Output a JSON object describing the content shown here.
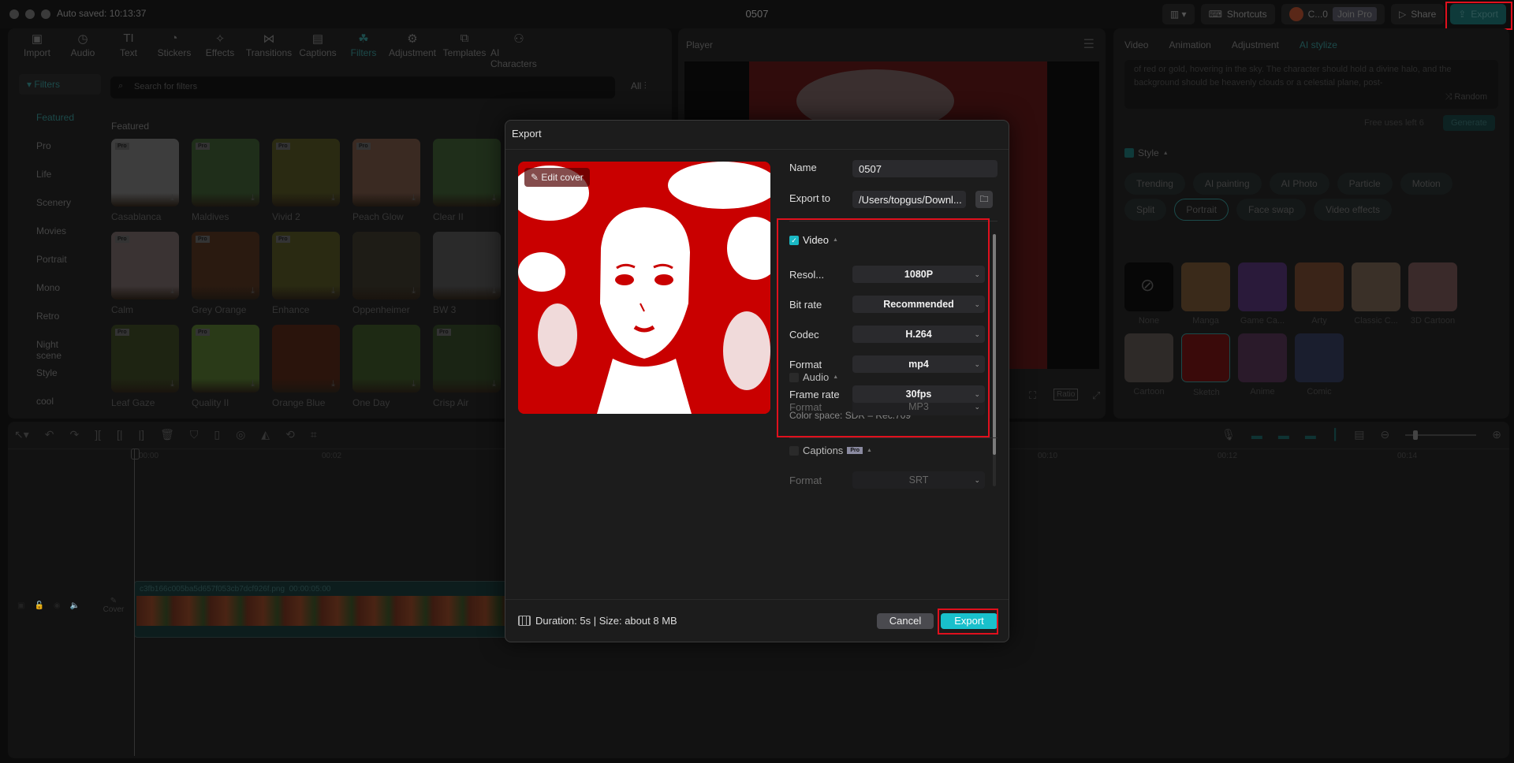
{
  "window": {
    "title": "0507",
    "autosave": "Auto saved: 10:13:37"
  },
  "titlebar": {
    "shortcuts": "Shortcuts",
    "account": "C...0",
    "join_pro": "Join Pro",
    "share": "Share",
    "export": "Export"
  },
  "media_toolbar": {
    "tools": [
      {
        "label": "Import",
        "icon": "import-icon"
      },
      {
        "label": "Audio",
        "icon": "audio-icon"
      },
      {
        "label": "Text",
        "icon": "text-icon"
      },
      {
        "label": "Stickers",
        "icon": "stickers-icon"
      },
      {
        "label": "Effects",
        "icon": "effects-icon"
      },
      {
        "label": "Transitions",
        "icon": "transitions-icon"
      },
      {
        "label": "Captions",
        "icon": "captions-icon"
      },
      {
        "label": "Filters",
        "icon": "filters-icon",
        "active": true
      },
      {
        "label": "Adjustment",
        "icon": "adjustment-icon"
      },
      {
        "label": "Templates",
        "icon": "templates-icon"
      },
      {
        "label": "AI Characters",
        "icon": "ai-characters-icon"
      }
    ]
  },
  "filters": {
    "header": "Filters",
    "categories": [
      "Featured",
      "Pro",
      "Life",
      "Scenery",
      "Movies",
      "Portrait",
      "Mono",
      "Retro",
      "Night scene",
      "Style",
      "cool"
    ],
    "active_category": "Featured",
    "search_placeholder": "Search for filters",
    "all_label": "All",
    "section_title": "Featured",
    "items": [
      {
        "name": "Casablanca",
        "pro": true
      },
      {
        "name": "Maldives",
        "pro": true
      },
      {
        "name": "Vivid 2",
        "pro": true
      },
      {
        "name": "Peach Glow",
        "pro": true
      },
      {
        "name": "Clear II",
        "pro": false
      },
      {
        "name": "Calm",
        "pro": true
      },
      {
        "name": "Grey Orange",
        "pro": true
      },
      {
        "name": "Enhance",
        "pro": true
      },
      {
        "name": "Oppenheimer",
        "pro": false
      },
      {
        "name": "BW 3",
        "pro": false
      },
      {
        "name": "Leaf Gaze",
        "pro": true
      },
      {
        "name": "Quality II",
        "pro": true
      },
      {
        "name": "Orange Blue",
        "pro": false
      },
      {
        "name": "One Day",
        "pro": false
      },
      {
        "name": "Crisp Air",
        "pro": true
      }
    ],
    "pro_badge": "Pro"
  },
  "player": {
    "title": "Player",
    "ratio": "Ratio"
  },
  "right_panel": {
    "tabs": [
      "Video",
      "Animation",
      "Adjustment",
      "AI stylize"
    ],
    "active_tab": "AI stylize",
    "prompt_text": "of red or gold, hovering in the sky. The character should hold a divine halo, and the background should be heavenly clouds or a celestial plane, post-",
    "random": "Random",
    "free_uses": "Free uses left 6",
    "generate": "Generate",
    "style_label": "Style",
    "chips_row1": [
      "Trending",
      "AI painting",
      "AI Photo",
      "Particle",
      "Motion"
    ],
    "chips_row2": [
      "Split",
      "Portrait",
      "Face swap",
      "Video effects"
    ],
    "active_chip": "Portrait",
    "styles": [
      "None",
      "Manga",
      "Game Ca...",
      "Arty",
      "Classic C...",
      "3D Cartoon",
      "Cartoon",
      "Sketch",
      "Anime",
      "Comic"
    ]
  },
  "timeline": {
    "ticks": [
      "00:00",
      "00:02",
      "00:10",
      "00:12",
      "00:14"
    ],
    "clip_name": "c3fb166c005ba5d657f053cb7dcf926f.png",
    "clip_duration": "00:00:05:00",
    "cover": "Cover"
  },
  "export_dialog": {
    "title": "Export",
    "edit_cover": "Edit cover",
    "name_label": "Name",
    "name_value": "0507",
    "export_to_label": "Export to",
    "export_to_value": "/Users/topgus/Downl...",
    "video": {
      "label": "Video",
      "checked": true,
      "fields": [
        {
          "label": "Resol...",
          "value": "1080P"
        },
        {
          "label": "Bit rate",
          "value": "Recommended"
        },
        {
          "label": "Codec",
          "value": "H.264"
        },
        {
          "label": "Format",
          "value": "mp4"
        },
        {
          "label": "Frame rate",
          "value": "30fps"
        }
      ],
      "color_space": "Color space: SDR – Rec.709"
    },
    "audio": {
      "label": "Audio",
      "checked": false,
      "format_label": "Format",
      "format_value": "MP3"
    },
    "captions": {
      "label": "Captions",
      "checked": false,
      "pro_badge": "Pro",
      "format_label": "Format",
      "format_value": "SRT"
    },
    "info": "Duration: 5s | Size: about 8 MB",
    "cancel": "Cancel",
    "export": "Export",
    "accent_color": "#19c0cc"
  }
}
